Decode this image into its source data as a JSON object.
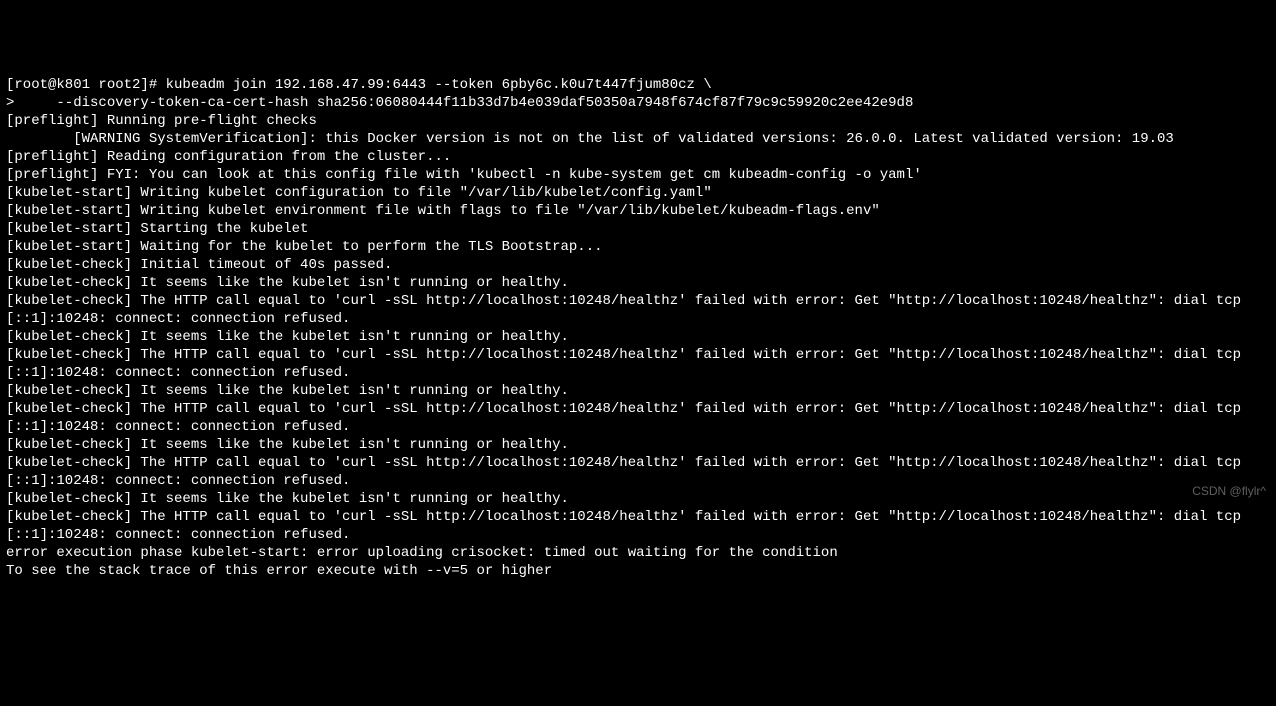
{
  "terminal": {
    "lines": [
      "[root@k801 root2]# kubeadm join 192.168.47.99:6443 --token 6pby6c.k0u7t447fjum80cz \\",
      ">     --discovery-token-ca-cert-hash sha256:06080444f11b33d7b4e039daf50350a7948f674cf87f79c9c59920c2ee42e9d8",
      "[preflight] Running pre-flight checks",
      "        [WARNING SystemVerification]: this Docker version is not on the list of validated versions: 26.0.0. Latest validated version: 19.03",
      "[preflight] Reading configuration from the cluster...",
      "[preflight] FYI: You can look at this config file with 'kubectl -n kube-system get cm kubeadm-config -o yaml'",
      "[kubelet-start] Writing kubelet configuration to file \"/var/lib/kubelet/config.yaml\"",
      "[kubelet-start] Writing kubelet environment file with flags to file \"/var/lib/kubelet/kubeadm-flags.env\"",
      "[kubelet-start] Starting the kubelet",
      "[kubelet-start] Waiting for the kubelet to perform the TLS Bootstrap...",
      "[kubelet-check] Initial timeout of 40s passed.",
      "[kubelet-check] It seems like the kubelet isn't running or healthy.",
      "[kubelet-check] The HTTP call equal to 'curl -sSL http://localhost:10248/healthz' failed with error: Get \"http://localhost:10248/healthz\": dial tcp [::1]:10248: connect: connection refused.",
      "[kubelet-check] It seems like the kubelet isn't running or healthy.",
      "[kubelet-check] The HTTP call equal to 'curl -sSL http://localhost:10248/healthz' failed with error: Get \"http://localhost:10248/healthz\": dial tcp [::1]:10248: connect: connection refused.",
      "[kubelet-check] It seems like the kubelet isn't running or healthy.",
      "[kubelet-check] The HTTP call equal to 'curl -sSL http://localhost:10248/healthz' failed with error: Get \"http://localhost:10248/healthz\": dial tcp [::1]:10248: connect: connection refused.",
      "[kubelet-check] It seems like the kubelet isn't running or healthy.",
      "[kubelet-check] The HTTP call equal to 'curl -sSL http://localhost:10248/healthz' failed with error: Get \"http://localhost:10248/healthz\": dial tcp [::1]:10248: connect: connection refused.",
      "[kubelet-check] It seems like the kubelet isn't running or healthy.",
      "[kubelet-check] The HTTP call equal to 'curl -sSL http://localhost:10248/healthz' failed with error: Get \"http://localhost:10248/healthz\": dial tcp [::1]:10248: connect: connection refused.",
      "error execution phase kubelet-start: error uploading crisocket: timed out waiting for the condition",
      "To see the stack trace of this error execute with --v=5 or higher"
    ]
  },
  "watermark": "CSDN @flylr^"
}
